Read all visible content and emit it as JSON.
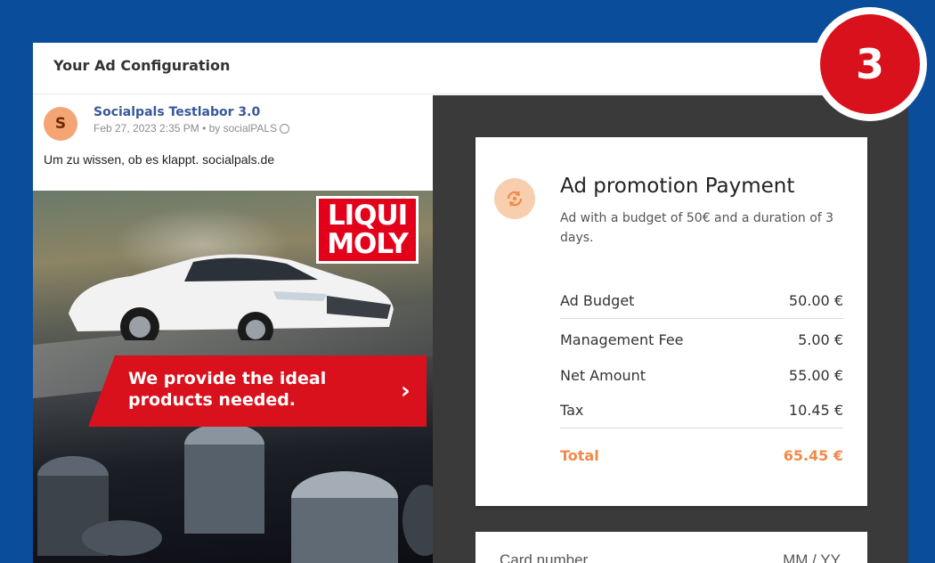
{
  "header": {
    "title": "Your Ad Configuration"
  },
  "post": {
    "avatar_letter": "S",
    "author": "Socialpals Testlabor 3.0",
    "meta": "Feb 27, 2023 2:35 PM • by socialPALS",
    "text": "Um zu wissen, ob es klappt. socialpals.de"
  },
  "ad_image": {
    "brand_line1": "LIQUI",
    "brand_line2": "MOLY",
    "banner_text": "We provide the ideal products needed.",
    "banner_arrow": "›"
  },
  "payment": {
    "title": "Ad promotion Payment",
    "description": "Ad with a budget of 50€ and a duration of 3 days.",
    "rows": [
      {
        "label": "Ad Budget",
        "value": "50.00 €"
      },
      {
        "label": "Management Fee",
        "value": "5.00 €"
      },
      {
        "label": "Net Amount",
        "value": "55.00 €"
      },
      {
        "label": "Tax",
        "value": "10.45 €"
      }
    ],
    "total": {
      "label": "Total",
      "value": "65.45 €"
    },
    "accent_color": "#f08a4b"
  },
  "card_input": {
    "card_number_placeholder": "Card number",
    "expiry_placeholder": "MM / YY"
  },
  "step_badge": {
    "number": "3",
    "color": "#d9111c"
  },
  "colors": {
    "background": "#0a4d9b",
    "dark_panel": "#3a3a3a"
  }
}
